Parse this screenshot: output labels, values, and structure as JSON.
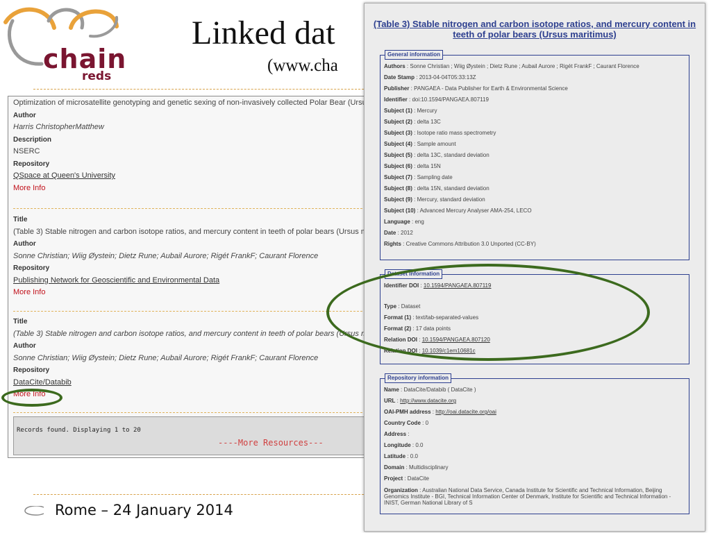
{
  "logo": {
    "name": "chain",
    "sub": "reds"
  },
  "slide": {
    "title": "Linked dat",
    "url": "(www.cha"
  },
  "footer": {
    "text": "Rome – 24 January 2014"
  },
  "results": {
    "records": [
      {
        "rows": [
          {
            "t": "Optimization of microsatellite genotyping and genetic sexing of non-invasively collected Polar Bear (Ursu",
            "c": ""
          },
          {
            "t": "Author",
            "c": "lbl"
          },
          {
            "t": "Harris ChristopherMatthew",
            "c": "it"
          },
          {
            "t": "Description",
            "c": "lbl"
          },
          {
            "t": "NSERC",
            "c": ""
          },
          {
            "t": "Repository",
            "c": "lbl"
          },
          {
            "t": "QSpace at Queen's University",
            "c": "lnk"
          },
          {
            "t": "More Info",
            "c": "more"
          }
        ]
      },
      {
        "rows": [
          {
            "t": "Title",
            "c": "lbl"
          },
          {
            "t": "(Table 3) Stable nitrogen and carbon isotope ratios, and mercury content in teeth of polar bears (Ursus m",
            "c": ""
          },
          {
            "t": "Author",
            "c": "lbl"
          },
          {
            "t": "Sonne Christian; Wiig Øystein; Dietz Rune; Aubail Aurore; Rigét FrankF; Caurant Florence",
            "c": "it"
          },
          {
            "t": "Repository",
            "c": "lbl"
          },
          {
            "t": "Publishing Network for Geoscientific and Environmental Data",
            "c": "lnk"
          },
          {
            "t": "More Info",
            "c": "more"
          }
        ]
      },
      {
        "rows": [
          {
            "t": "Title",
            "c": "lbl"
          },
          {
            "t": "(Table 3) Stable nitrogen and carbon isotope ratios, and mercury content in teeth of polar bears (Ursus m",
            "c": "it"
          },
          {
            "t": "Author",
            "c": "lbl"
          },
          {
            "t": "Sonne Christian; Wiig Øystein; Dietz Rune; Aubail Aurore; Rigét FrankF; Caurant Florence",
            "c": "it"
          },
          {
            "t": "Repository",
            "c": "lbl"
          },
          {
            "t": "DataCite/Databib",
            "c": "lnk"
          },
          {
            "t": "More Info",
            "c": "more"
          }
        ]
      }
    ],
    "records_found": "Records found. Displaying 1 to 20",
    "more_resources": "----More Resources---"
  },
  "detail": {
    "title": "(Table 3) Stable nitrogen and carbon isotope ratios, and mercury content in teeth of polar bears (Ursus maritimus)",
    "general": {
      "legend": "General information",
      "rows": [
        {
          "k": "Authors",
          "v": "Sonne Christian ; Wiig Øystein ; Dietz Rune ; Aubail Aurore ; Rigét FrankF ; Caurant Florence"
        },
        {
          "k": "Date Stamp",
          "v": "2013-04-04T05:33:13Z"
        },
        {
          "k": "Publisher",
          "v": "PANGAEA - Data Publisher for Earth & Environmental Science"
        },
        {
          "k": "Identifier",
          "v": "doi:10.1594/PANGAEA.807119"
        },
        {
          "k": "Subject (1)",
          "v": "Mercury"
        },
        {
          "k": "Subject (2)",
          "v": "delta 13C"
        },
        {
          "k": "Subject (3)",
          "v": "Isotope ratio mass spectrometry"
        },
        {
          "k": "Subject (4)",
          "v": "Sample amount"
        },
        {
          "k": "Subject (5)",
          "v": "delta 13C, standard deviation"
        },
        {
          "k": "Subject (6)",
          "v": "delta 15N"
        },
        {
          "k": "Subject (7)",
          "v": "Sampling date"
        },
        {
          "k": "Subject (8)",
          "v": "delta 15N, standard deviation"
        },
        {
          "k": "Subject (9)",
          "v": "Mercury, standard deviation"
        },
        {
          "k": "Subject (10)",
          "v": "Advanced Mercury Analyser AMA-254, LECO"
        },
        {
          "k": "Language",
          "v": "eng"
        },
        {
          "k": "Date",
          "v": "2012"
        },
        {
          "k": "Rights",
          "v": "Creative Commons Attribution 3.0 Unported (CC-BY)"
        }
      ]
    },
    "dataset": {
      "legend": "Dataset information",
      "rows": [
        {
          "k": "Identifier DOI",
          "v": "10.1594/PANGAEA.807119",
          "link": true
        },
        {
          "k": "Type",
          "v": "Dataset"
        },
        {
          "k": "Format (1)",
          "v": "text/tab-separated-values"
        },
        {
          "k": "Format (2)",
          "v": "17 data points"
        },
        {
          "k": "Relation DOI",
          "v": "10.1594/PANGAEA.807120",
          "link": true
        },
        {
          "k": "Relation DOI",
          "v": "10.1039/c1em10681c",
          "link": true
        }
      ]
    },
    "repository": {
      "legend": "Repository information",
      "rows": [
        {
          "k": "Name",
          "v": "DataCite/Databib ( DataCite )"
        },
        {
          "k": "URL",
          "v": "http://www.datacite.org",
          "link": true
        },
        {
          "k": "OAI-PMH address",
          "v": "http://oai.datacite.org/oai",
          "link": true
        },
        {
          "k": "Country Code",
          "v": "0"
        },
        {
          "k": "Address",
          "v": ""
        },
        {
          "k": "Longitude",
          "v": "0.0"
        },
        {
          "k": "Latitude",
          "v": "0.0"
        },
        {
          "k": "Domain",
          "v": "Multidisciplinary"
        },
        {
          "k": "Project",
          "v": "DataCite"
        },
        {
          "k": "Organization",
          "v": "Australian National Data Service, Canada Institute for Scientific and Technical Information, Beijing Genomics Institute - BGI, Technical Information Center of Denmark, Institute for Scientific and Technical Information - INIST, German National Library of S"
        }
      ]
    }
  }
}
